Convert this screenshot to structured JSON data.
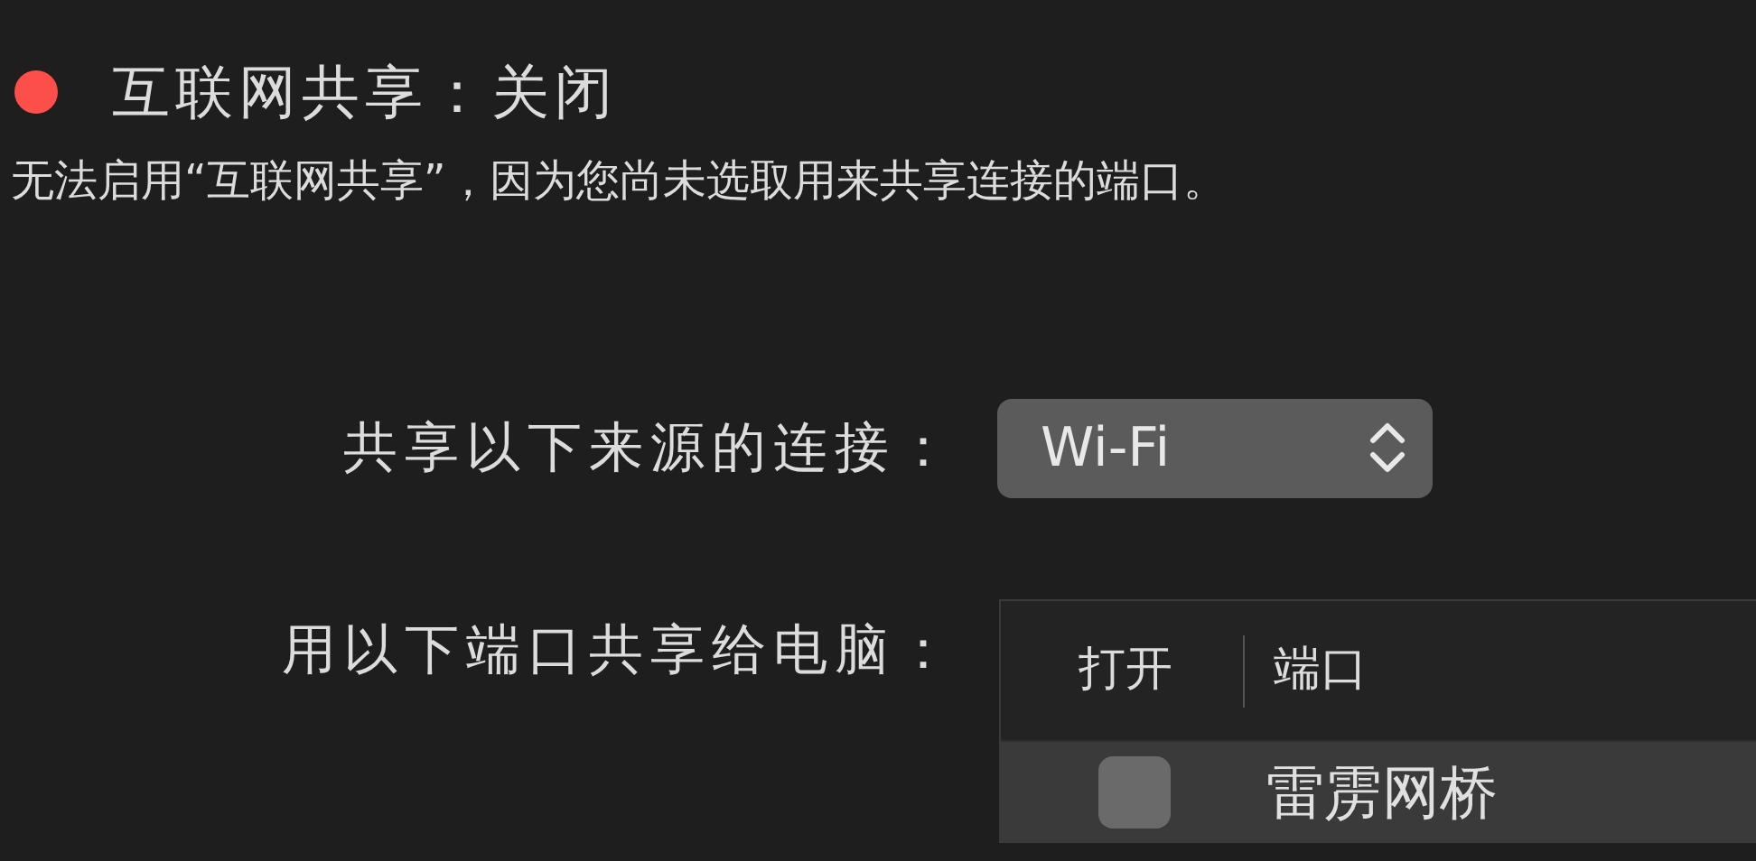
{
  "status": {
    "title": "互联网共享：关闭",
    "on": false
  },
  "message": "无法启用“互联网共享”，因为您尚未选取用来共享连接的端口。",
  "source": {
    "label": "共享以下来源的连接：",
    "value": "Wi-Fi"
  },
  "ports": {
    "label": "用以下端口共享给电脑：",
    "columns": [
      "打开",
      "端口"
    ],
    "rows": [
      {
        "checked": false,
        "name": "雷雳网桥"
      }
    ]
  }
}
